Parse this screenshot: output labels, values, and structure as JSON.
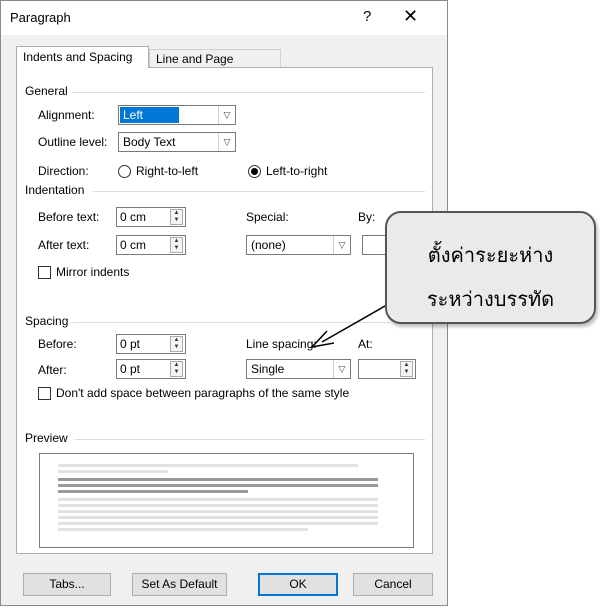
{
  "dialog": {
    "title": "Paragraph",
    "help": "?",
    "close": "✕"
  },
  "tabs": [
    {
      "label": "Indents and Spacing",
      "active": true
    },
    {
      "label": "Line and Page Breaks",
      "active": false
    }
  ],
  "general": {
    "section": "General",
    "alignment_label": "Alignment:",
    "alignment_value": "Left",
    "outline_label": "Outline level:",
    "outline_value": "Body Text",
    "direction_label": "Direction:",
    "rtl_label": "Right-to-left",
    "ltr_label": "Left-to-right",
    "selected_direction": "Left-to-right"
  },
  "indentation": {
    "section": "Indentation",
    "before_label": "Before text:",
    "before_value": "0 cm",
    "after_label": "After text:",
    "after_value": "0 cm",
    "special_label": "Special:",
    "special_value": "(none)",
    "by_label": "By:",
    "mirror_label": "Mirror indents",
    "mirror_checked": false
  },
  "spacing": {
    "section": "Spacing",
    "before_label": "Before:",
    "before_value": "0 pt",
    "after_label": "After:",
    "after_value": "0 pt",
    "line_label": "Line spacing:",
    "line_value": "Single",
    "at_label": "At:",
    "dont_add_label": "Don't add space between paragraphs of the same style",
    "dont_add_checked": false
  },
  "preview": {
    "section": "Preview"
  },
  "buttons": {
    "tabs": "Tabs...",
    "default": "Set As Default",
    "ok": "OK",
    "cancel": "Cancel"
  },
  "callout": {
    "line1": "ตั้งค่าระยะห่าง",
    "line2": "ระหว่างบรรทัด"
  },
  "colors": {
    "accent": "#0078d7",
    "dialog_bg": "#f0f0f0",
    "callout_bg": "#eaeaea"
  }
}
